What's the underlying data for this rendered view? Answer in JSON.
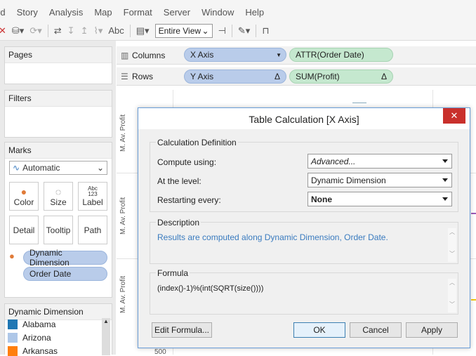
{
  "menu": [
    "rd",
    "Story",
    "Analysis",
    "Map",
    "Format",
    "Server",
    "Window",
    "Help"
  ],
  "toolbar": {
    "text_label": "Abc",
    "view_select": "Entire View"
  },
  "panels": {
    "pages": "Pages",
    "filters": "Filters",
    "marks": "Marks",
    "legend_title": "Dynamic Dimension"
  },
  "marks": {
    "type": "Automatic",
    "buttons": [
      "Color",
      "Size",
      "Label",
      "Detail",
      "Tooltip",
      "Path"
    ],
    "label_icon": "Abc\n123",
    "pills": [
      "Dynamic Dimension",
      "Order Date"
    ]
  },
  "legend": {
    "items": [
      {
        "name": "Alabama",
        "color": "#1f77b4"
      },
      {
        "name": "Arizona",
        "color": "#aec7e8"
      },
      {
        "name": "Arkansas",
        "color": "#ff7f0e"
      }
    ]
  },
  "shelves": {
    "columns_label": "Columns",
    "rows_label": "Rows",
    "col_pill1": "X Axis",
    "col_pill2": "ATTR(Order Date)",
    "row_pill1": "Y Axis",
    "row_pill2": "SUM(Profit)",
    "delta": "Δ"
  },
  "viz": {
    "axis_label": "M. Av. Profit",
    "tick": "500"
  },
  "dialog": {
    "title": "Table Calculation [X Axis]",
    "calc_def": "Calculation Definition",
    "compute_label": "Compute using:",
    "compute_value": "Advanced...",
    "level_label": "At the level:",
    "level_value": "Dynamic Dimension",
    "restart_label": "Restarting every:",
    "restart_value": "None",
    "desc_label": "Description",
    "desc_text": "Results are computed along Dynamic Dimension, Order Date.",
    "formula_label": "Formula",
    "formula_text": "(index()-1)%(int(SQRT(size())))",
    "edit_button": "Edit Formula...",
    "ok_button": "OK",
    "cancel_button": "Cancel",
    "apply_button": "Apply"
  },
  "colors": {
    "accent": "#6a9ed8",
    "close": "#c9302c",
    "pill_blue": "#b9ccea",
    "pill_green": "#c5e8cf",
    "desc_text": "#3a7bbf"
  }
}
